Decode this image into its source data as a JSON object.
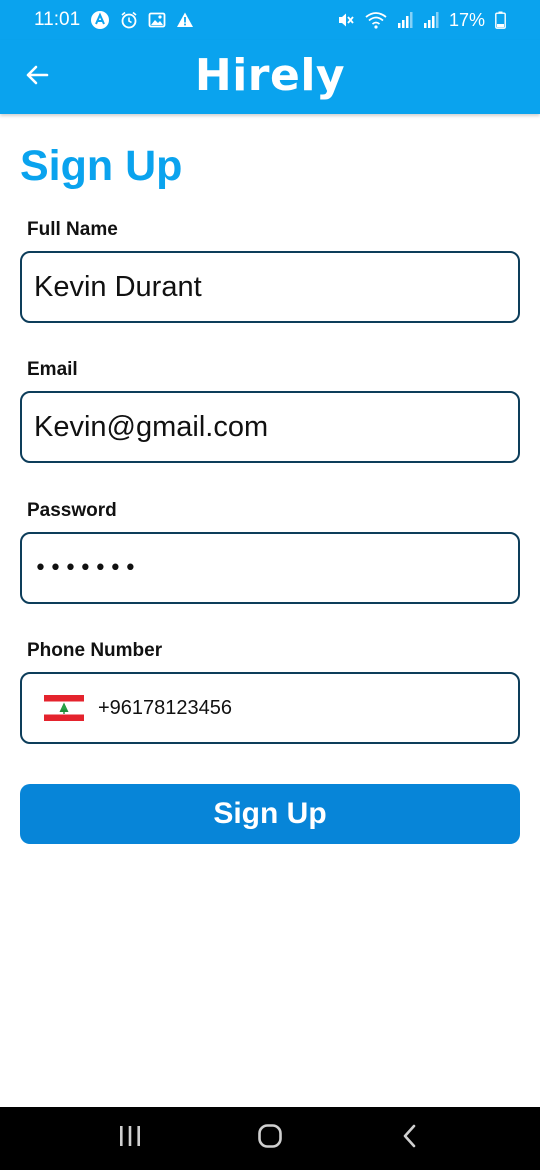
{
  "status_bar": {
    "time": "11:01",
    "battery": "17%",
    "icons_left": [
      "app-notification-icon",
      "alarm-icon",
      "image-icon",
      "warning-icon"
    ],
    "icons_right": [
      "mute-icon",
      "wifi-icon",
      "signal-icon",
      "signal-icon",
      "battery-icon"
    ]
  },
  "app_bar": {
    "logo": "Hirely",
    "back_icon": "arrow-left-icon"
  },
  "page": {
    "title": "Sign Up"
  },
  "form": {
    "full_name": {
      "label": "Full Name",
      "value": "Kevin Durant"
    },
    "email": {
      "label": "Email",
      "value": "Kevin@gmail.com"
    },
    "password": {
      "label": "Password",
      "value": "•••••••"
    },
    "phone": {
      "label": "Phone Number",
      "value": "+96178123456",
      "country_flag": "lebanon-flag-icon"
    },
    "submit_label": "Sign Up"
  },
  "nav_bar": {
    "buttons": [
      "recent-apps-icon",
      "home-icon",
      "back-icon"
    ]
  },
  "colors": {
    "primary": "#0aa3ee",
    "button": "#0785d8",
    "field_border": "#0d3d5a"
  }
}
